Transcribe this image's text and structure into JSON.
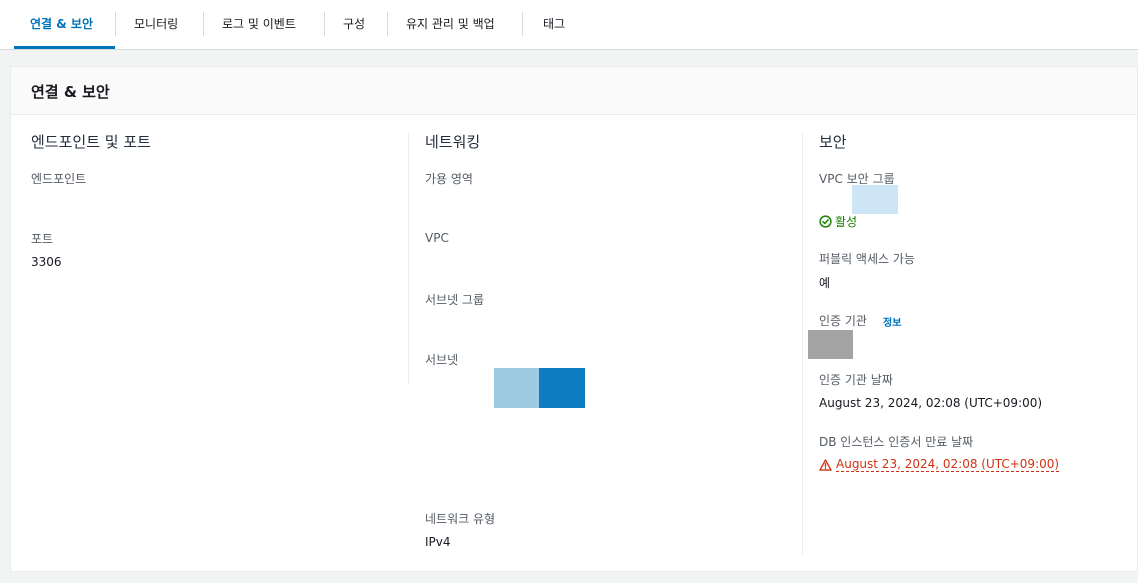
{
  "tabs": [
    {
      "label": "연결 & 보안",
      "active": true
    },
    {
      "label": "모니터링"
    },
    {
      "label": "로그 및 이벤트"
    },
    {
      "label": "구성"
    },
    {
      "label": "유지 관리 및 백업"
    },
    {
      "label": "태그"
    }
  ],
  "panel": {
    "title": "연결 & 보안"
  },
  "endpoints": {
    "heading": "엔드포인트 및 포트",
    "endpoint_label": "엔드포인트",
    "port_label": "포트",
    "port_value": "3306"
  },
  "networking": {
    "heading": "네트워킹",
    "az_label": "가용 영역",
    "vpc_label": "VPC",
    "subnet_group_label": "서브넷 그룹",
    "subnets_label": "서브넷",
    "network_type_label": "네트워크 유형",
    "network_type_value": "IPv4"
  },
  "security": {
    "heading": "보안",
    "vpc_sg_label": "VPC 보안 그룹",
    "sg_status": "활성",
    "public_access_label": "퍼블릭 액세스 가능",
    "public_access_value": "예",
    "ca_label": "인증 기관",
    "ca_info_link": "정보",
    "ca_date_label": "인증 기관 날짜",
    "ca_date_value": "August 23, 2024, 02:08 (UTC+09:00)",
    "cert_expiry_label": "DB 인스턴스 인증서 만료 날짜",
    "cert_expiry_value": "August 23, 2024, 02:08 (UTC+09:00)"
  },
  "colors": {
    "accent": "#0073bb",
    "success": "#1d8102",
    "warning": "#d13212"
  }
}
